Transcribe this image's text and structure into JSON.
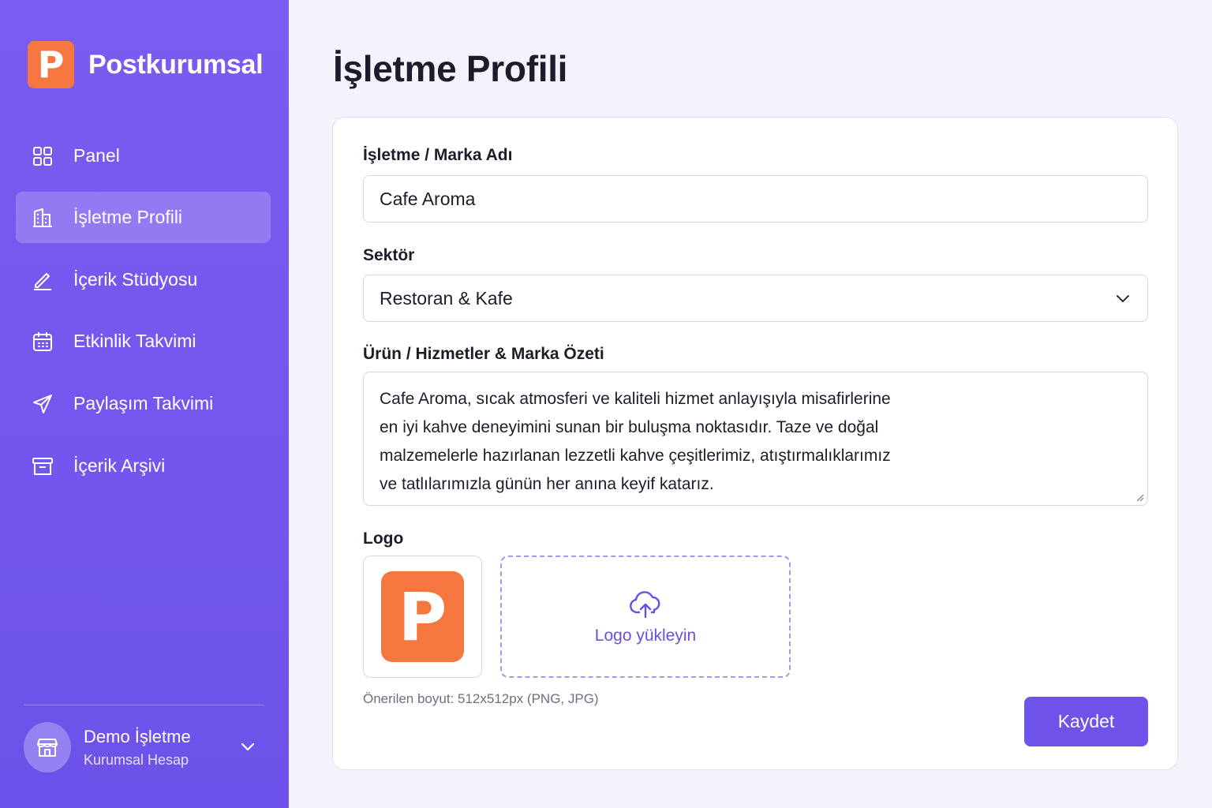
{
  "app": {
    "brand_name": "Postkurumsal",
    "brand_letter": "P",
    "brand_color": "#f5763f",
    "accent": "#6f52ea"
  },
  "sidebar": {
    "items": [
      {
        "label": "Panel",
        "icon": "grid-icon",
        "active": false
      },
      {
        "label": "İşletme Profili",
        "icon": "building-icon",
        "active": true
      },
      {
        "label": "İçerik Stüdyosu",
        "icon": "pen-icon",
        "active": false
      },
      {
        "label": "Etkinlik Takvimi",
        "icon": "calendar-icon",
        "active": false
      },
      {
        "label": "Paylaşım Takvimi",
        "icon": "send-icon",
        "active": false
      },
      {
        "label": "İçerik Arşivi",
        "icon": "archive-icon",
        "active": false
      }
    ],
    "account": {
      "name": "Demo İşletme",
      "role": "Kurumsal Hesap",
      "icon": "store-icon"
    }
  },
  "main": {
    "title": "İşletme Profili",
    "form": {
      "name_label": "İşletme / Marka Adı",
      "name_value": "Cafe Aroma",
      "sector_label": "Sektör",
      "sector_value": "Restoran & Kafe",
      "summary_label": "Ürün / Hizmetler & Marka Özeti",
      "summary_lines": [
        "Cafe Aroma, sıcak atmosferi ve kaliteli hizmet anlayışıyla misafirlerine",
        "en iyi kahve deneyimini sunan bir buluşma noktasıdır. Taze ve doğal",
        "malzemelerle hazırlanan lezzetli kahve çeşitlerimiz, atıştırmalıklarımız",
        "ve tatlılarımızla günün her anına keyif katarız."
      ],
      "logo_label": "Logo",
      "logo_letter": "P",
      "upload_label": "Logo yükleyin",
      "hint": "Önerilen boyut: 512x512px (PNG, JPG)",
      "save_label": "Kaydet"
    }
  }
}
